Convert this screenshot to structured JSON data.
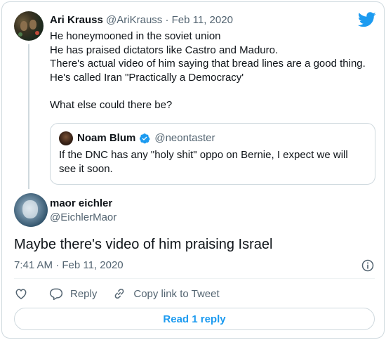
{
  "parent_tweet": {
    "author_name": "Ari Krauss",
    "author_handle": "@AriKrauss",
    "separator": "·",
    "date": "Feb 11, 2020",
    "lines": [
      "He honeymooned  in the soviet union",
      "He has praised dictators like Castro and Maduro.",
      "There's actual video of him saying that bread lines are a good thing.",
      "He's called Iran \"Practically a Democracy'",
      "",
      "What else could there be?"
    ]
  },
  "quoted_tweet": {
    "author_name": "Noam Blum",
    "author_handle": "@neontaster",
    "text": "If the DNC has any \"holy shit\" oppo on Bernie, I expect we will see it soon."
  },
  "main_tweet": {
    "author_name": "maor eichler",
    "author_handle": "@EichlerMaor",
    "text": "Maybe there's video of him praising Israel",
    "timestamp": "7:41 AM · Feb 11, 2020"
  },
  "actions": {
    "reply_label": "Reply",
    "copy_link_label": "Copy link to Tweet"
  },
  "read_reply_label": "Read 1 reply",
  "colors": {
    "accent": "#1d9bf0",
    "text": "#0f1419",
    "muted": "#536471",
    "border": "#cfd9de"
  },
  "icons": [
    "twitter-bird-icon",
    "verified-badge-icon",
    "info-icon",
    "heart-icon",
    "reply-icon",
    "link-icon"
  ]
}
